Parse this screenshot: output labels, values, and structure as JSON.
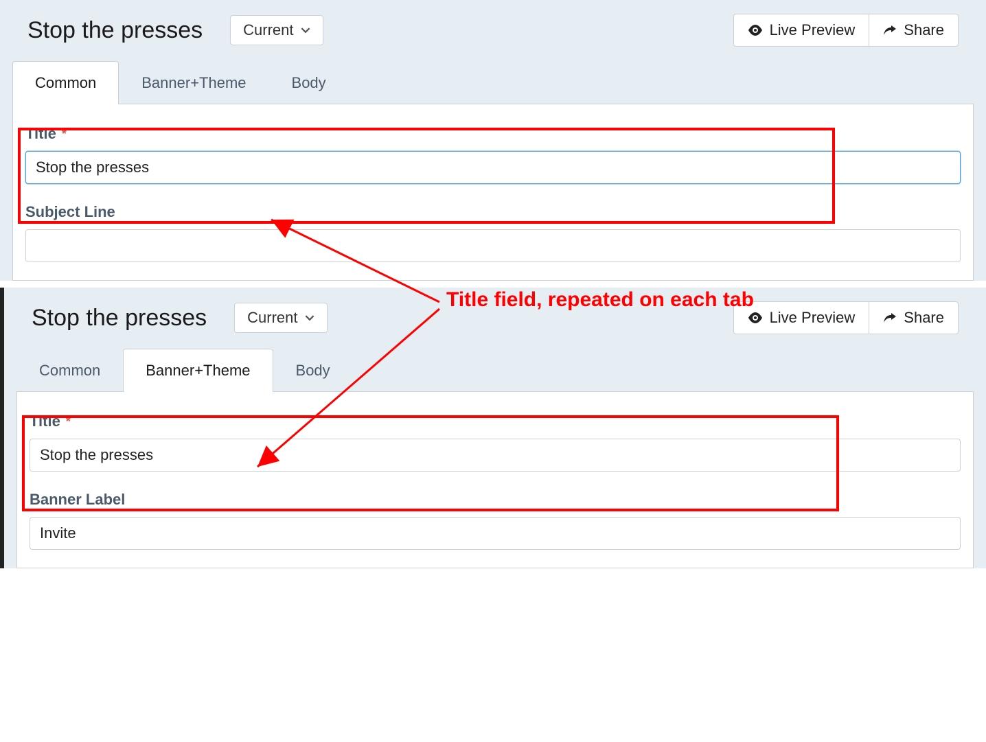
{
  "panels": [
    {
      "title": "Stop the presses",
      "version_label": "Current",
      "actions": {
        "preview": "Live Preview",
        "share": "Share"
      },
      "tabs": [
        "Common",
        "Banner+Theme",
        "Body"
      ],
      "active_tab": 0,
      "fields": {
        "title_label": "Title",
        "title_value": "Stop the presses",
        "second_label": "Subject Line",
        "second_value": ""
      }
    },
    {
      "title": "Stop the presses",
      "version_label": "Current",
      "actions": {
        "preview": "Live Preview",
        "share": "Share"
      },
      "tabs": [
        "Common",
        "Banner+Theme",
        "Body"
      ],
      "active_tab": 1,
      "fields": {
        "title_label": "Title",
        "title_value": "Stop the presses",
        "second_label": "Banner Label",
        "second_value": "Invite"
      }
    }
  ],
  "annotation": "Title field, repeated on each tab"
}
